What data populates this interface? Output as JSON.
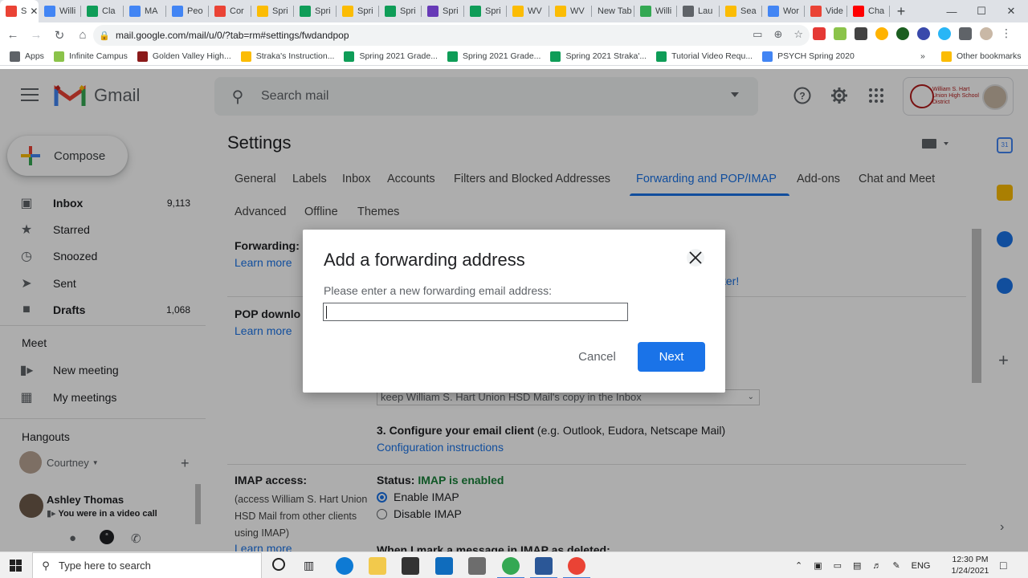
{
  "browser": {
    "tabs": [
      {
        "label": "S",
        "color": "#ea4335",
        "active": true
      },
      {
        "label": "Willi",
        "color": "#4285f4"
      },
      {
        "label": "Cla",
        "color": "#0f9d58"
      },
      {
        "label": "MA",
        "color": "#4285f4"
      },
      {
        "label": "Peo",
        "color": "#4285f4"
      },
      {
        "label": "Cor",
        "color": "#ea4335"
      },
      {
        "label": "Spri",
        "color": "#fbbc04"
      },
      {
        "label": "Spri",
        "color": "#0f9d58"
      },
      {
        "label": "Spri",
        "color": "#fbbc04"
      },
      {
        "label": "Spri",
        "color": "#0f9d58"
      },
      {
        "label": "Spri",
        "color": "#673ab7"
      },
      {
        "label": "Spri",
        "color": "#0f9d58"
      },
      {
        "label": "WV",
        "color": "#fbbc04"
      },
      {
        "label": "WV",
        "color": "#fbbc04"
      },
      {
        "label": "New Tab",
        "color": ""
      },
      {
        "label": "Willi",
        "color": "#34a853"
      },
      {
        "label": "Lau",
        "color": "#5f6368"
      },
      {
        "label": "Sea",
        "color": "#fbbc04"
      },
      {
        "label": "Wor",
        "color": "#4285f4"
      },
      {
        "label": "Vide",
        "color": "#ea4335"
      },
      {
        "label": "Cha",
        "color": "#ff0000"
      }
    ],
    "url": "mail.google.com/mail/u/0/?tab=rm#settings/fwdandpop",
    "bookmarks": [
      {
        "label": "Apps",
        "color": "#5f6368"
      },
      {
        "label": "Infinite Campus",
        "color": "#8bc34a"
      },
      {
        "label": "Golden Valley High...",
        "color": "#8b1a1a"
      },
      {
        "label": "Straka's Instruction...",
        "color": "#fbbc04"
      },
      {
        "label": "Spring 2021 Grade...",
        "color": "#0f9d58"
      },
      {
        "label": "Spring 2021 Grade...",
        "color": "#0f9d58"
      },
      {
        "label": "Spring 2021 Straka'...",
        "color": "#0f9d58"
      },
      {
        "label": "Tutorial Video Requ...",
        "color": "#0f9d58"
      },
      {
        "label": "PSYCH Spring 2020",
        "color": "#4285f4"
      }
    ],
    "other_bookmarks": "Other bookmarks"
  },
  "gmail": {
    "app_name": "Gmail",
    "search_placeholder": "Search mail",
    "compose_label": "Compose",
    "nav": [
      {
        "label": "Inbox",
        "count": "9,113",
        "icon": "inbox-icon",
        "bold": true
      },
      {
        "label": "Starred",
        "count": "",
        "icon": "star-icon"
      },
      {
        "label": "Snoozed",
        "count": "",
        "icon": "clock-icon"
      },
      {
        "label": "Sent",
        "count": "",
        "icon": "send-icon"
      },
      {
        "label": "Drafts",
        "count": "1,068",
        "icon": "draft-icon",
        "bold": true
      }
    ],
    "meet": {
      "title": "Meet",
      "items": [
        {
          "label": "New meeting",
          "icon": "video-icon"
        },
        {
          "label": "My meetings",
          "icon": "calendar-icon"
        }
      ]
    },
    "hangouts": {
      "title": "Hangouts",
      "user": "Courtney",
      "contact_name": "Ashley Thomas",
      "contact_status": "You were in a video call"
    },
    "account_org": "William S. Hart Union High School District"
  },
  "settings": {
    "title": "Settings",
    "tabs": [
      "General",
      "Labels",
      "Inbox",
      "Accounts",
      "Filters and Blocked Addresses",
      "Forwarding and POP/IMAP",
      "Add-ons",
      "Chat and Meet",
      "Advanced",
      "Offline",
      "Themes"
    ],
    "active_tab": "Forwarding and POP/IMAP",
    "forwarding_label": "Forwarding:",
    "learn_more": "Learn more",
    "pop_label": "POP downlo",
    "filter_link_tail": "ter!",
    "select_value": "keep William S. Hart Union HSD Mail's copy in the Inbox",
    "step3_bold": "3. Configure your email client",
    "step3_rest": " (e.g. Outlook, Eudora, Netscape Mail)",
    "config_link": "Configuration instructions",
    "imap_label": "IMAP access:",
    "imap_desc": "(access William S. Hart Union HSD Mail from other clients using IMAP)",
    "imap_learn_more": "Learn more",
    "status_label": "Status:",
    "status_value": "IMAP is enabled",
    "enable_imap": "Enable IMAP",
    "disable_imap": "Disable IMAP",
    "deleted_heading": "When I mark a message in IMAP as deleted:"
  },
  "dialog": {
    "title": "Add a forwarding address",
    "prompt": "Please enter a new forwarding email address:",
    "input_value": "",
    "cancel_label": "Cancel",
    "next_label": "Next"
  },
  "taskbar": {
    "search_placeholder": "Type here to search",
    "language": "ENG",
    "time": "12:30 PM",
    "date": "1/24/2021"
  },
  "colors": {
    "accent": "#1a73e8",
    "imap_status": "#188038",
    "overlay": "rgba(0,0,0,0.32)"
  }
}
